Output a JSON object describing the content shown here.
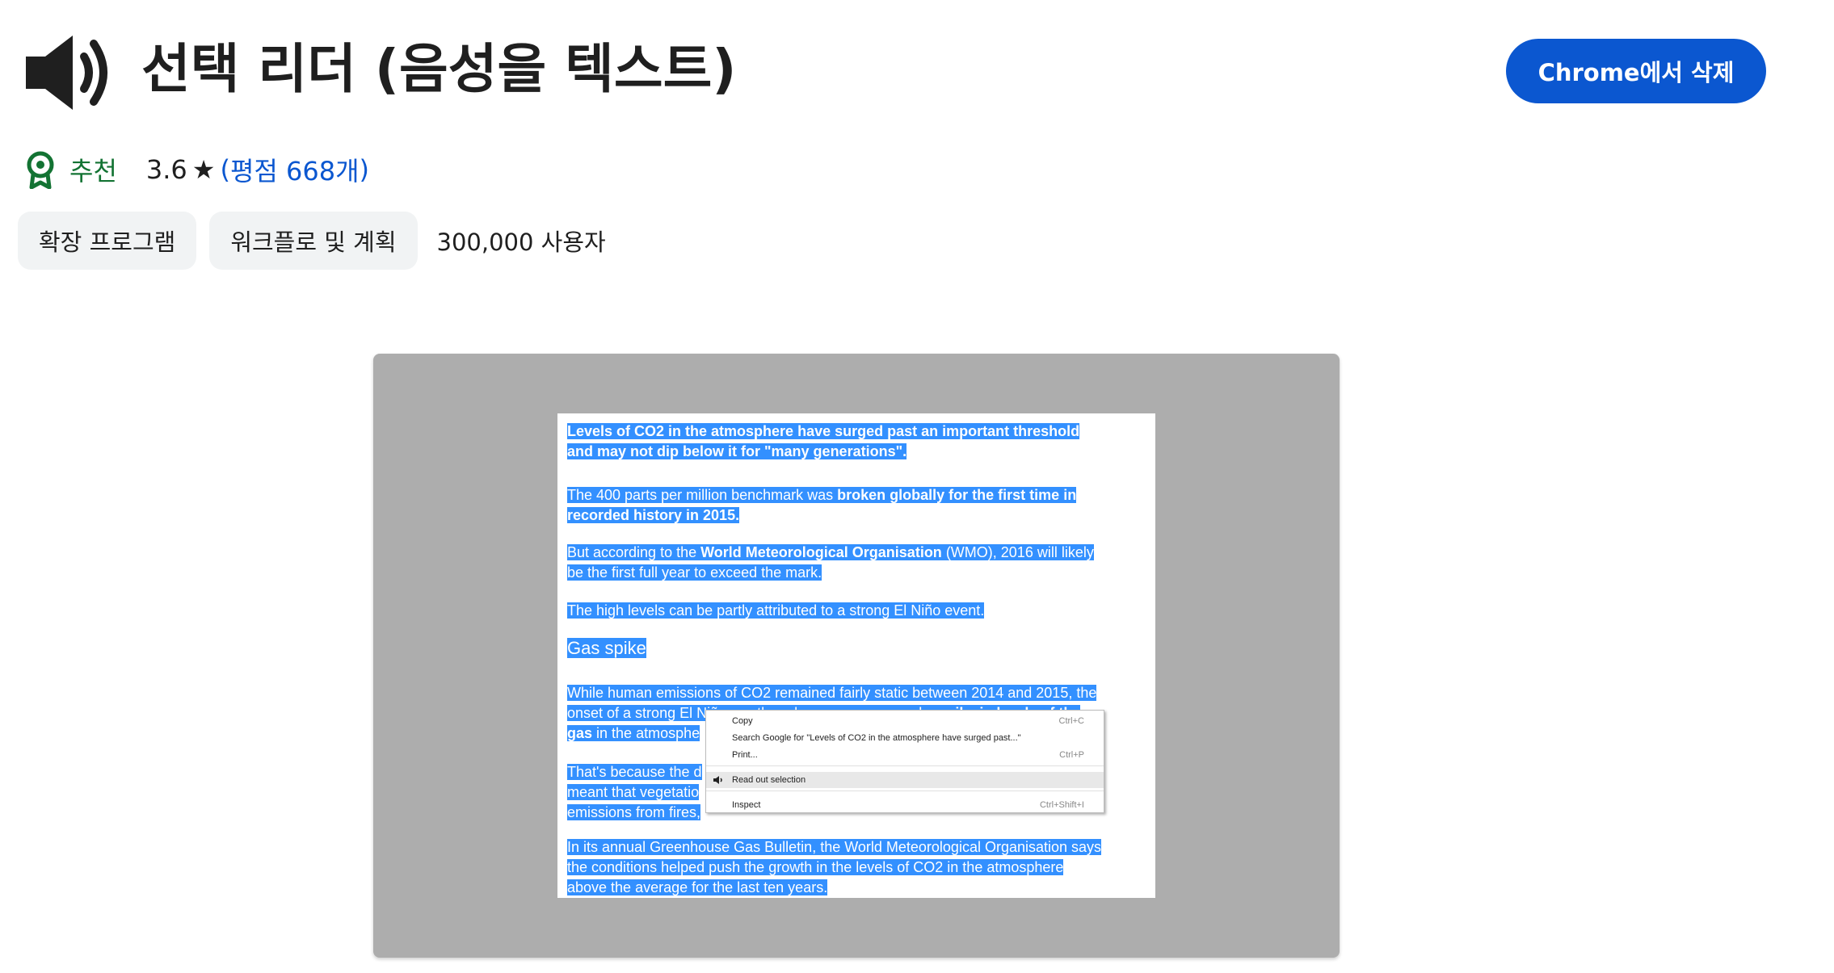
{
  "extension": {
    "title": "선택 리더 (음성을 텍스트)",
    "remove_button": "Chrome에서 삭제",
    "featured_label": "추천",
    "rating": "3.6",
    "ratings_link": "평점 668개",
    "paren_open": "(",
    "paren_close": ")",
    "chips": [
      "확장 프로그램",
      "워크플로 및 계획"
    ],
    "users": "300,000 사용자",
    "icons": {
      "title": "speaker-icon",
      "featured": "featured-badge-icon",
      "star": "star-icon"
    },
    "colors": {
      "primary": "#0b57d0",
      "featured": "#137333",
      "chip_bg": "#f1f3f4"
    }
  },
  "screenshot": {
    "paragraphs": [
      {
        "lines": [
          [
            {
              "t": "Levels of CO2 in the atmosphere have surged past an important threshold",
              "b": true
            }
          ],
          [
            {
              "t": "and may not dip below it for \"many generations\".",
              "b": true
            }
          ]
        ]
      },
      {
        "lines": [
          [
            {
              "t": "The 400 parts per million benchmark was ",
              "b": false
            },
            {
              "t": "broken globally for the first time in",
              "b": true
            }
          ],
          [
            {
              "t": "recorded history in 2015.",
              "b": true
            }
          ]
        ]
      },
      {
        "lines": [
          [
            {
              "t": "But according to the ",
              "b": false
            },
            {
              "t": "World Meteorological Organisation",
              "b": true
            },
            {
              "t": " (WMO), 2016 will likely",
              "b": false
            }
          ],
          [
            {
              "t": "be the first full year to exceed the mark.",
              "b": false
            }
          ]
        ]
      },
      {
        "lines": [
          [
            {
              "t": "The high levels can be partly attributed to a strong El Niño event.",
              "b": false
            }
          ]
        ]
      },
      {
        "heading": "Gas spike"
      },
      {
        "lines": [
          [
            {
              "t": "While human emissions of CO2 remained fairly static between 2014 and 2015, the",
              "b": false
            }
          ],
          [
            {
              "t": "onset of a strong El Niño weather phenomenon caused ",
              "b": false
            },
            {
              "t": "a spike in levels of the",
              "b": true
            }
          ],
          [
            {
              "t": "gas",
              "b": true
            },
            {
              "t": " in the atmosphe",
              "b": false
            }
          ]
        ]
      },
      {
        "lines": [
          [
            {
              "t": "That's because the d",
              "b": false
            }
          ],
          [
            {
              "t": "meant that vegetatio",
              "b": false
            }
          ],
          [
            {
              "t": "emissions from fires,",
              "b": false
            }
          ]
        ]
      },
      {
        "lines": [
          [
            {
              "t": "In its annual Greenhouse Gas Bulletin, the World Meteorological Organisation says",
              "b": false
            }
          ],
          [
            {
              "t": "the conditions helped push the growth in the levels of CO2 in the atmosphere",
              "b": false
            }
          ],
          [
            {
              "t": "above the average for the last ten years.",
              "b": false
            }
          ]
        ]
      }
    ],
    "context_menu": [
      {
        "label": "Copy",
        "shortcut": "Ctrl+C"
      },
      {
        "label": "Search Google for \"Levels of CO2 in the atmosphere have surged past...\"",
        "shortcut": ""
      },
      {
        "label": "Print...",
        "shortcut": "Ctrl+P"
      },
      {
        "label": "Read out selection",
        "shortcut": "",
        "icon": "speaker-icon",
        "active": true
      },
      {
        "label": "Inspect",
        "shortcut": "Ctrl+Shift+I"
      }
    ]
  }
}
